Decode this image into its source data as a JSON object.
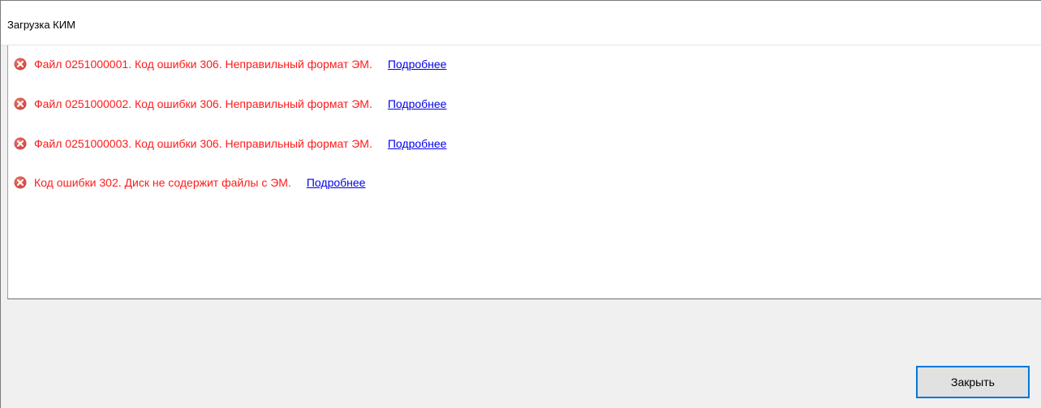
{
  "window": {
    "title": "Загрузка КИМ"
  },
  "messages": [
    {
      "icon": "error-icon",
      "text": "Файл 0251000001. Код ошибки 306. Неправильный формат ЭМ.",
      "link": "Подробнее"
    },
    {
      "icon": "error-icon",
      "text": "Файл 0251000002. Код ошибки 306. Неправильный формат ЭМ.",
      "link": "Подробнее"
    },
    {
      "icon": "error-icon",
      "text": "Файл 0251000003. Код ошибки 306. Неправильный формат ЭМ.",
      "link": "Подробнее"
    },
    {
      "icon": "error-icon",
      "text": "Код ошибки 302. Диск не содержит файлы с ЭМ.",
      "link": "Подробнее"
    }
  ],
  "footer": {
    "close_label": "Закрыть"
  },
  "colors": {
    "error_text": "#ff1a1a",
    "link": "#0000ee",
    "button_focus_border": "#0078d7",
    "error_icon": "#d9534f"
  }
}
